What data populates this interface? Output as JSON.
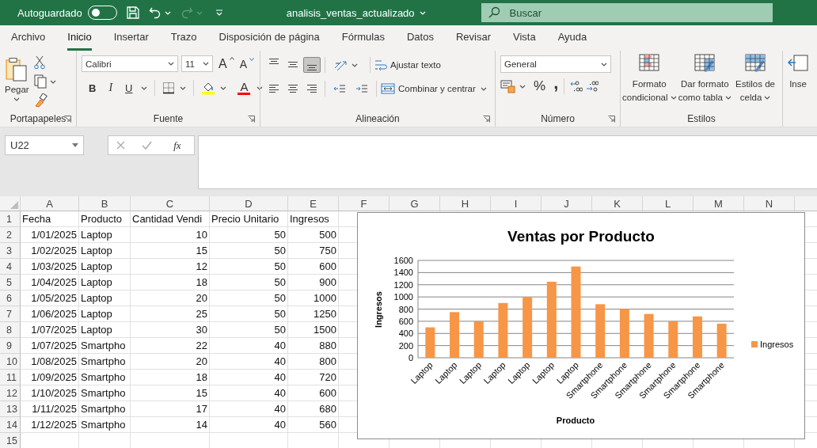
{
  "title_bar": {
    "autosave_label": "Autoguardado",
    "autosave_on": false,
    "filename": "analisis_ventas_actualizado",
    "search_placeholder": "Buscar"
  },
  "tabs": [
    {
      "label": "Archivo",
      "selected": false
    },
    {
      "label": "Inicio",
      "selected": true
    },
    {
      "label": "Insertar",
      "selected": false
    },
    {
      "label": "Trazo",
      "selected": false
    },
    {
      "label": "Disposición de página",
      "selected": false
    },
    {
      "label": "Fórmulas",
      "selected": false
    },
    {
      "label": "Datos",
      "selected": false
    },
    {
      "label": "Revisar",
      "selected": false
    },
    {
      "label": "Vista",
      "selected": false
    },
    {
      "label": "Ayuda",
      "selected": false
    }
  ],
  "ribbon": {
    "clipboard": {
      "paste_label": "Pegar",
      "group_label": "Portapapeles"
    },
    "font": {
      "font_name": "Calibri",
      "font_size": "11",
      "grow_label": "A",
      "shrink_label": "A",
      "bold_label": "B",
      "italic_label": "I",
      "underline_label": "U",
      "color_label": "A",
      "group_label": "Fuente"
    },
    "alignment": {
      "vertical_align": [
        {
          "selected": false
        },
        {
          "selected": false
        },
        {
          "selected": true
        }
      ],
      "wrap_label": "Ajustar texto",
      "merge_label": "Combinar y centrar",
      "group_label": "Alineación"
    },
    "number": {
      "format": "General",
      "percent_label": "%",
      "comma_label": ",",
      "group_label": "Número"
    },
    "styles": {
      "buttons": [
        {
          "lines": [
            "Formato",
            "condicional"
          ]
        },
        {
          "lines": [
            "Dar formato",
            "como tabla"
          ]
        },
        {
          "lines": [
            "Estilos de",
            "celda"
          ]
        }
      ],
      "group_label": "Estilos"
    },
    "cells": {
      "insert_label": "Inse"
    }
  },
  "formula_bar": {
    "name_box": "U22",
    "function_label": "fx"
  },
  "sheet": {
    "columns": [
      "A",
      "B",
      "C",
      "D",
      "E",
      "F",
      "G",
      "H",
      "I",
      "J",
      "K",
      "L",
      "M",
      "N"
    ],
    "rows": [
      {
        "number": "1",
        "cells": [
          {
            "kind": "text",
            "text": "Fecha"
          },
          {
            "kind": "text",
            "text": "Producto"
          },
          {
            "kind": "text",
            "text": "Cantidad Vendi"
          },
          {
            "kind": "text",
            "text": "Precio Unitario"
          },
          {
            "kind": "text",
            "text": "Ingresos"
          }
        ]
      },
      {
        "number": "2",
        "cells": [
          {
            "kind": "number",
            "text": "1/01/2025"
          },
          {
            "kind": "text",
            "text": "Laptop"
          },
          {
            "kind": "number",
            "text": "10"
          },
          {
            "kind": "number",
            "text": "50"
          },
          {
            "kind": "number",
            "text": "500"
          }
        ]
      },
      {
        "number": "3",
        "cells": [
          {
            "kind": "number",
            "text": "1/02/2025"
          },
          {
            "kind": "text",
            "text": "Laptop"
          },
          {
            "kind": "number",
            "text": "15"
          },
          {
            "kind": "number",
            "text": "50"
          },
          {
            "kind": "number",
            "text": "750"
          }
        ]
      },
      {
        "number": "4",
        "cells": [
          {
            "kind": "number",
            "text": "1/03/2025"
          },
          {
            "kind": "text",
            "text": "Laptop"
          },
          {
            "kind": "number",
            "text": "12"
          },
          {
            "kind": "number",
            "text": "50"
          },
          {
            "kind": "number",
            "text": "600"
          }
        ]
      },
      {
        "number": "5",
        "cells": [
          {
            "kind": "number",
            "text": "1/04/2025"
          },
          {
            "kind": "text",
            "text": "Laptop"
          },
          {
            "kind": "number",
            "text": "18"
          },
          {
            "kind": "number",
            "text": "50"
          },
          {
            "kind": "number",
            "text": "900"
          }
        ]
      },
      {
        "number": "6",
        "cells": [
          {
            "kind": "number",
            "text": "1/05/2025"
          },
          {
            "kind": "text",
            "text": "Laptop"
          },
          {
            "kind": "number",
            "text": "20"
          },
          {
            "kind": "number",
            "text": "50"
          },
          {
            "kind": "number",
            "text": "1000"
          }
        ]
      },
      {
        "number": "7",
        "cells": [
          {
            "kind": "number",
            "text": "1/06/2025"
          },
          {
            "kind": "text",
            "text": "Laptop"
          },
          {
            "kind": "number",
            "text": "25"
          },
          {
            "kind": "number",
            "text": "50"
          },
          {
            "kind": "number",
            "text": "1250"
          }
        ]
      },
      {
        "number": "8",
        "cells": [
          {
            "kind": "number",
            "text": "1/07/2025"
          },
          {
            "kind": "text",
            "text": "Laptop"
          },
          {
            "kind": "number",
            "text": "30"
          },
          {
            "kind": "number",
            "text": "50"
          },
          {
            "kind": "number",
            "text": "1500"
          }
        ]
      },
      {
        "number": "9",
        "cells": [
          {
            "kind": "number",
            "text": "1/07/2025"
          },
          {
            "kind": "text",
            "text": "Smartpho"
          },
          {
            "kind": "number",
            "text": "22"
          },
          {
            "kind": "number",
            "text": "40"
          },
          {
            "kind": "number",
            "text": "880"
          }
        ]
      },
      {
        "number": "10",
        "cells": [
          {
            "kind": "number",
            "text": "1/08/2025"
          },
          {
            "kind": "text",
            "text": "Smartpho"
          },
          {
            "kind": "number",
            "text": "20"
          },
          {
            "kind": "number",
            "text": "40"
          },
          {
            "kind": "number",
            "text": "800"
          }
        ]
      },
      {
        "number": "11",
        "cells": [
          {
            "kind": "number",
            "text": "1/09/2025"
          },
          {
            "kind": "text",
            "text": "Smartpho"
          },
          {
            "kind": "number",
            "text": "18"
          },
          {
            "kind": "number",
            "text": "40"
          },
          {
            "kind": "number",
            "text": "720"
          }
        ]
      },
      {
        "number": "12",
        "cells": [
          {
            "kind": "number",
            "text": "1/10/2025"
          },
          {
            "kind": "text",
            "text": "Smartpho"
          },
          {
            "kind": "number",
            "text": "15"
          },
          {
            "kind": "number",
            "text": "40"
          },
          {
            "kind": "number",
            "text": "600"
          }
        ]
      },
      {
        "number": "13",
        "cells": [
          {
            "kind": "number",
            "text": "1/11/2025"
          },
          {
            "kind": "text",
            "text": "Smartpho"
          },
          {
            "kind": "number",
            "text": "17"
          },
          {
            "kind": "number",
            "text": "40"
          },
          {
            "kind": "number",
            "text": "680"
          }
        ]
      },
      {
        "number": "14",
        "cells": [
          {
            "kind": "number",
            "text": "1/12/2025"
          },
          {
            "kind": "text",
            "text": "Smartpho"
          },
          {
            "kind": "number",
            "text": "14"
          },
          {
            "kind": "number",
            "text": "40"
          },
          {
            "kind": "number",
            "text": "560"
          }
        ]
      },
      {
        "number": "15",
        "cells": []
      }
    ]
  },
  "chart": {
    "chart_data": {
      "type": "bar",
      "title": "Ventas por Producto",
      "xlabel": "Producto",
      "ylabel": "Ingresos",
      "categories": [
        "Laptop",
        "Laptop",
        "Laptop",
        "Laptop",
        "Laptop",
        "Laptop",
        "Laptop",
        "Smartphone",
        "Smartphone",
        "Smartphone",
        "Smartphone",
        "Smartphone",
        "Smartphone"
      ],
      "series": [
        {
          "name": "Ingresos",
          "color": "#f79646",
          "values": [
            500,
            750,
            600,
            900,
            1000,
            1250,
            1500,
            880,
            800,
            720,
            600,
            680,
            560
          ]
        }
      ],
      "grid": true,
      "ylim": [
        0,
        1600
      ],
      "yticks": [
        0,
        200,
        400,
        600,
        800,
        1000,
        1200,
        1400,
        1600
      ]
    }
  }
}
